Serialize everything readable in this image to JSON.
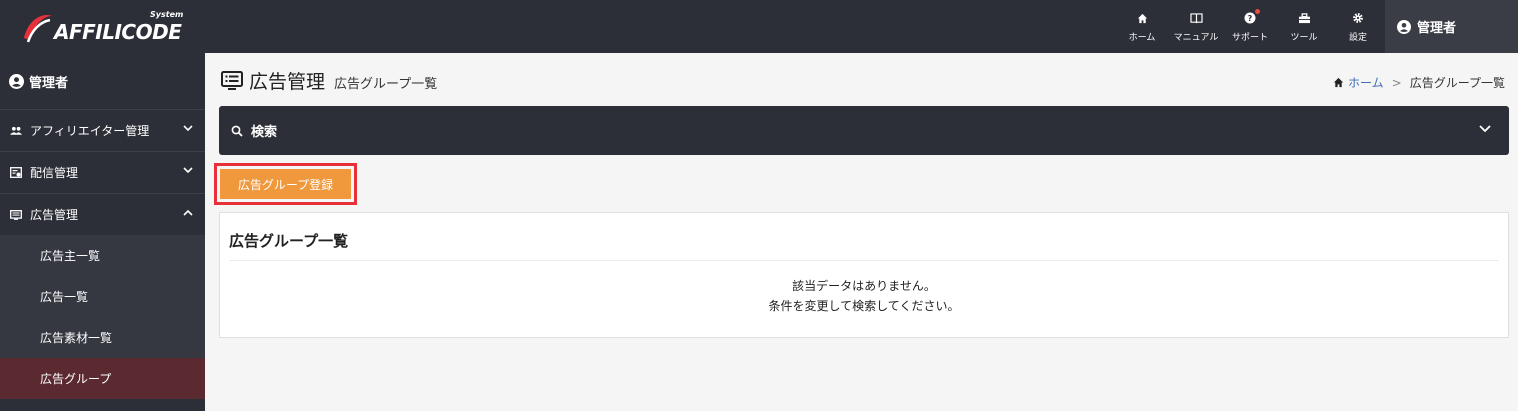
{
  "header": {
    "logo": {
      "name": "AFFILICODE",
      "tag": "System"
    },
    "nav": [
      {
        "label": "ホーム",
        "icon": "home-icon"
      },
      {
        "label": "マニュアル",
        "icon": "book-icon"
      },
      {
        "label": "サポート",
        "icon": "help-icon"
      },
      {
        "label": "ツール",
        "icon": "toolbox-icon"
      },
      {
        "label": "設定",
        "icon": "gear-icon"
      }
    ],
    "user": "管理者"
  },
  "sidebar": {
    "user": "管理者",
    "items": [
      {
        "label": "アフィリエイター管理",
        "icon": "people-icon"
      },
      {
        "label": "配信管理",
        "icon": "delivery-icon"
      },
      {
        "label": "広告管理",
        "icon": "ad-icon"
      }
    ],
    "subitems": [
      {
        "label": "広告主一覧"
      },
      {
        "label": "広告一覧"
      },
      {
        "label": "広告素材一覧"
      },
      {
        "label": "広告グループ"
      }
    ]
  },
  "page": {
    "title": "広告管理",
    "subtitle": "広告グループ一覧",
    "breadcrumb": {
      "home": "ホーム",
      "separator": ">",
      "current": "広告グループ一覧"
    }
  },
  "search": {
    "label": "検索"
  },
  "actions": {
    "register_label": "広告グループ登録"
  },
  "card": {
    "title": "広告グループ一覧",
    "empty_line1": "該当データはありません。",
    "empty_line2": "条件を変更して検索してください。"
  },
  "colors": {
    "dark": "#2d2f38",
    "accent_button": "#f0983c",
    "highlight_border": "#e8303a",
    "active_sub": "#5b2a30",
    "link": "#3d6fb6"
  }
}
